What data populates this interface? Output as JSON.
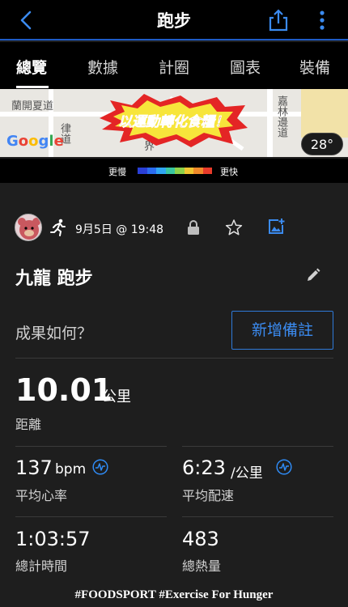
{
  "header": {
    "title": "跑步"
  },
  "tabs": [
    {
      "label": "總覽",
      "active": true
    },
    {
      "label": "數據"
    },
    {
      "label": "計圈"
    },
    {
      "label": "圖表"
    },
    {
      "label": "裝備"
    }
  ],
  "map": {
    "labels": [
      "蘭開夏道",
      "律道",
      "界",
      "嘉林邊道"
    ],
    "provider": "Google",
    "temperature": "28°",
    "banner_text": "以運動轉化食糧！"
  },
  "pace_legend": {
    "slow": "更慢",
    "fast": "更快",
    "colors": [
      "#2a3fd6",
      "#2a6cf0",
      "#2fa6f2",
      "#39c6a0",
      "#8dd14a",
      "#f0c531",
      "#f08a2a",
      "#e83b2a"
    ]
  },
  "activity": {
    "date": "9月5日 @ 19:48",
    "title": "九龍 跑步",
    "prompt": "成果如何？",
    "add_note": "新增備註"
  },
  "stats": {
    "distance": {
      "value": "10.01",
      "unit": "公里",
      "label": "距離"
    },
    "avg_hr": {
      "value": "137",
      "unit": "bpm",
      "label": "平均心率"
    },
    "avg_pace": {
      "value": "6:23",
      "unit": "/公里",
      "label": "平均配速"
    },
    "total_time": {
      "value": "1:03:57",
      "label": "總計時間"
    },
    "calories": {
      "value": "483",
      "label": "總熱量"
    }
  },
  "watermark": "#FOODSPORT #Exercise For Hunger"
}
